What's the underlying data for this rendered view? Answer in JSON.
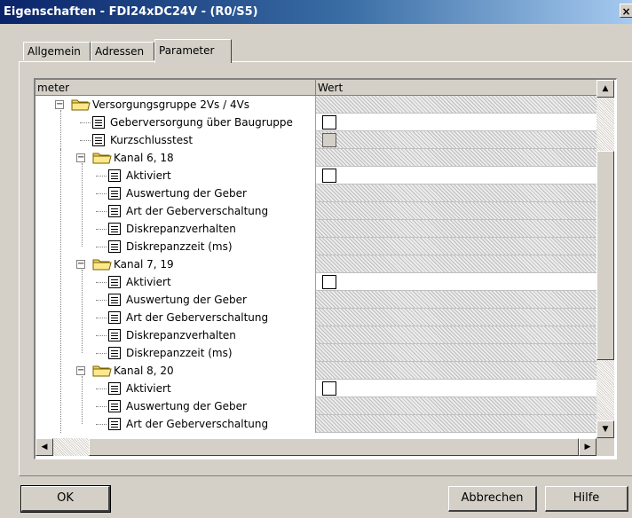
{
  "window": {
    "title": "Eigenschaften - FDI24xDC24V - (R0/S5)",
    "close": "×"
  },
  "tabs": [
    {
      "label": "Allgemein",
      "active": false
    },
    {
      "label": "Adressen",
      "active": false
    },
    {
      "label": "Parameter",
      "active": true
    }
  ],
  "grid": {
    "columns": {
      "param": "meter",
      "value": "Wert"
    },
    "rows": [
      {
        "label": "Versorgungsgruppe 2Vs / 4Vs",
        "type": "group",
        "level": 0,
        "value": "none"
      },
      {
        "label": "Geberversorgung über Baugruppe",
        "type": "item",
        "level": 1,
        "value": "checkbox"
      },
      {
        "label": "Kurzschlusstest",
        "type": "item",
        "level": 1,
        "value": "checkbox-disabled"
      },
      {
        "label": "Kanal 6, 18",
        "type": "group",
        "level": 1,
        "value": "none"
      },
      {
        "label": "Aktiviert",
        "type": "item",
        "level": 2,
        "value": "checkbox"
      },
      {
        "label": "Auswertung der Geber",
        "type": "item",
        "level": 2,
        "value": "none"
      },
      {
        "label": "Art der Geberverschaltung",
        "type": "item",
        "level": 2,
        "value": "none"
      },
      {
        "label": "Diskrepanzverhalten",
        "type": "item",
        "level": 2,
        "value": "none"
      },
      {
        "label": "Diskrepanzzeit (ms)",
        "type": "item",
        "level": 2,
        "value": "none"
      },
      {
        "label": "Kanal 7, 19",
        "type": "group",
        "level": 1,
        "value": "none"
      },
      {
        "label": "Aktiviert",
        "type": "item",
        "level": 2,
        "value": "checkbox"
      },
      {
        "label": "Auswertung der Geber",
        "type": "item",
        "level": 2,
        "value": "none"
      },
      {
        "label": "Art der Geberverschaltung",
        "type": "item",
        "level": 2,
        "value": "none"
      },
      {
        "label": "Diskrepanzverhalten",
        "type": "item",
        "level": 2,
        "value": "none"
      },
      {
        "label": "Diskrepanzzeit (ms)",
        "type": "item",
        "level": 2,
        "value": "none"
      },
      {
        "label": "Kanal 8, 20",
        "type": "group",
        "level": 1,
        "value": "none"
      },
      {
        "label": "Aktiviert",
        "type": "item",
        "level": 2,
        "value": "checkbox"
      },
      {
        "label": "Auswertung der Geber",
        "type": "item",
        "level": 2,
        "value": "none"
      },
      {
        "label": "Art der Geberverschaltung",
        "type": "item",
        "level": 2,
        "value": "none"
      }
    ]
  },
  "buttons": {
    "ok": "OK",
    "cancel": "Abbrechen",
    "help": "Hilfe"
  },
  "icons": {
    "scroll_up": "up-arrow-icon",
    "scroll_down": "down-arrow-icon",
    "scroll_left": "left-arrow-icon",
    "scroll_right": "right-arrow-icon",
    "folder": "folder-icon",
    "param": "parameter-icon"
  },
  "colors": {
    "title_bar": "#0a246a",
    "face": "#d4d0c8",
    "folder": "#f2d35a"
  }
}
